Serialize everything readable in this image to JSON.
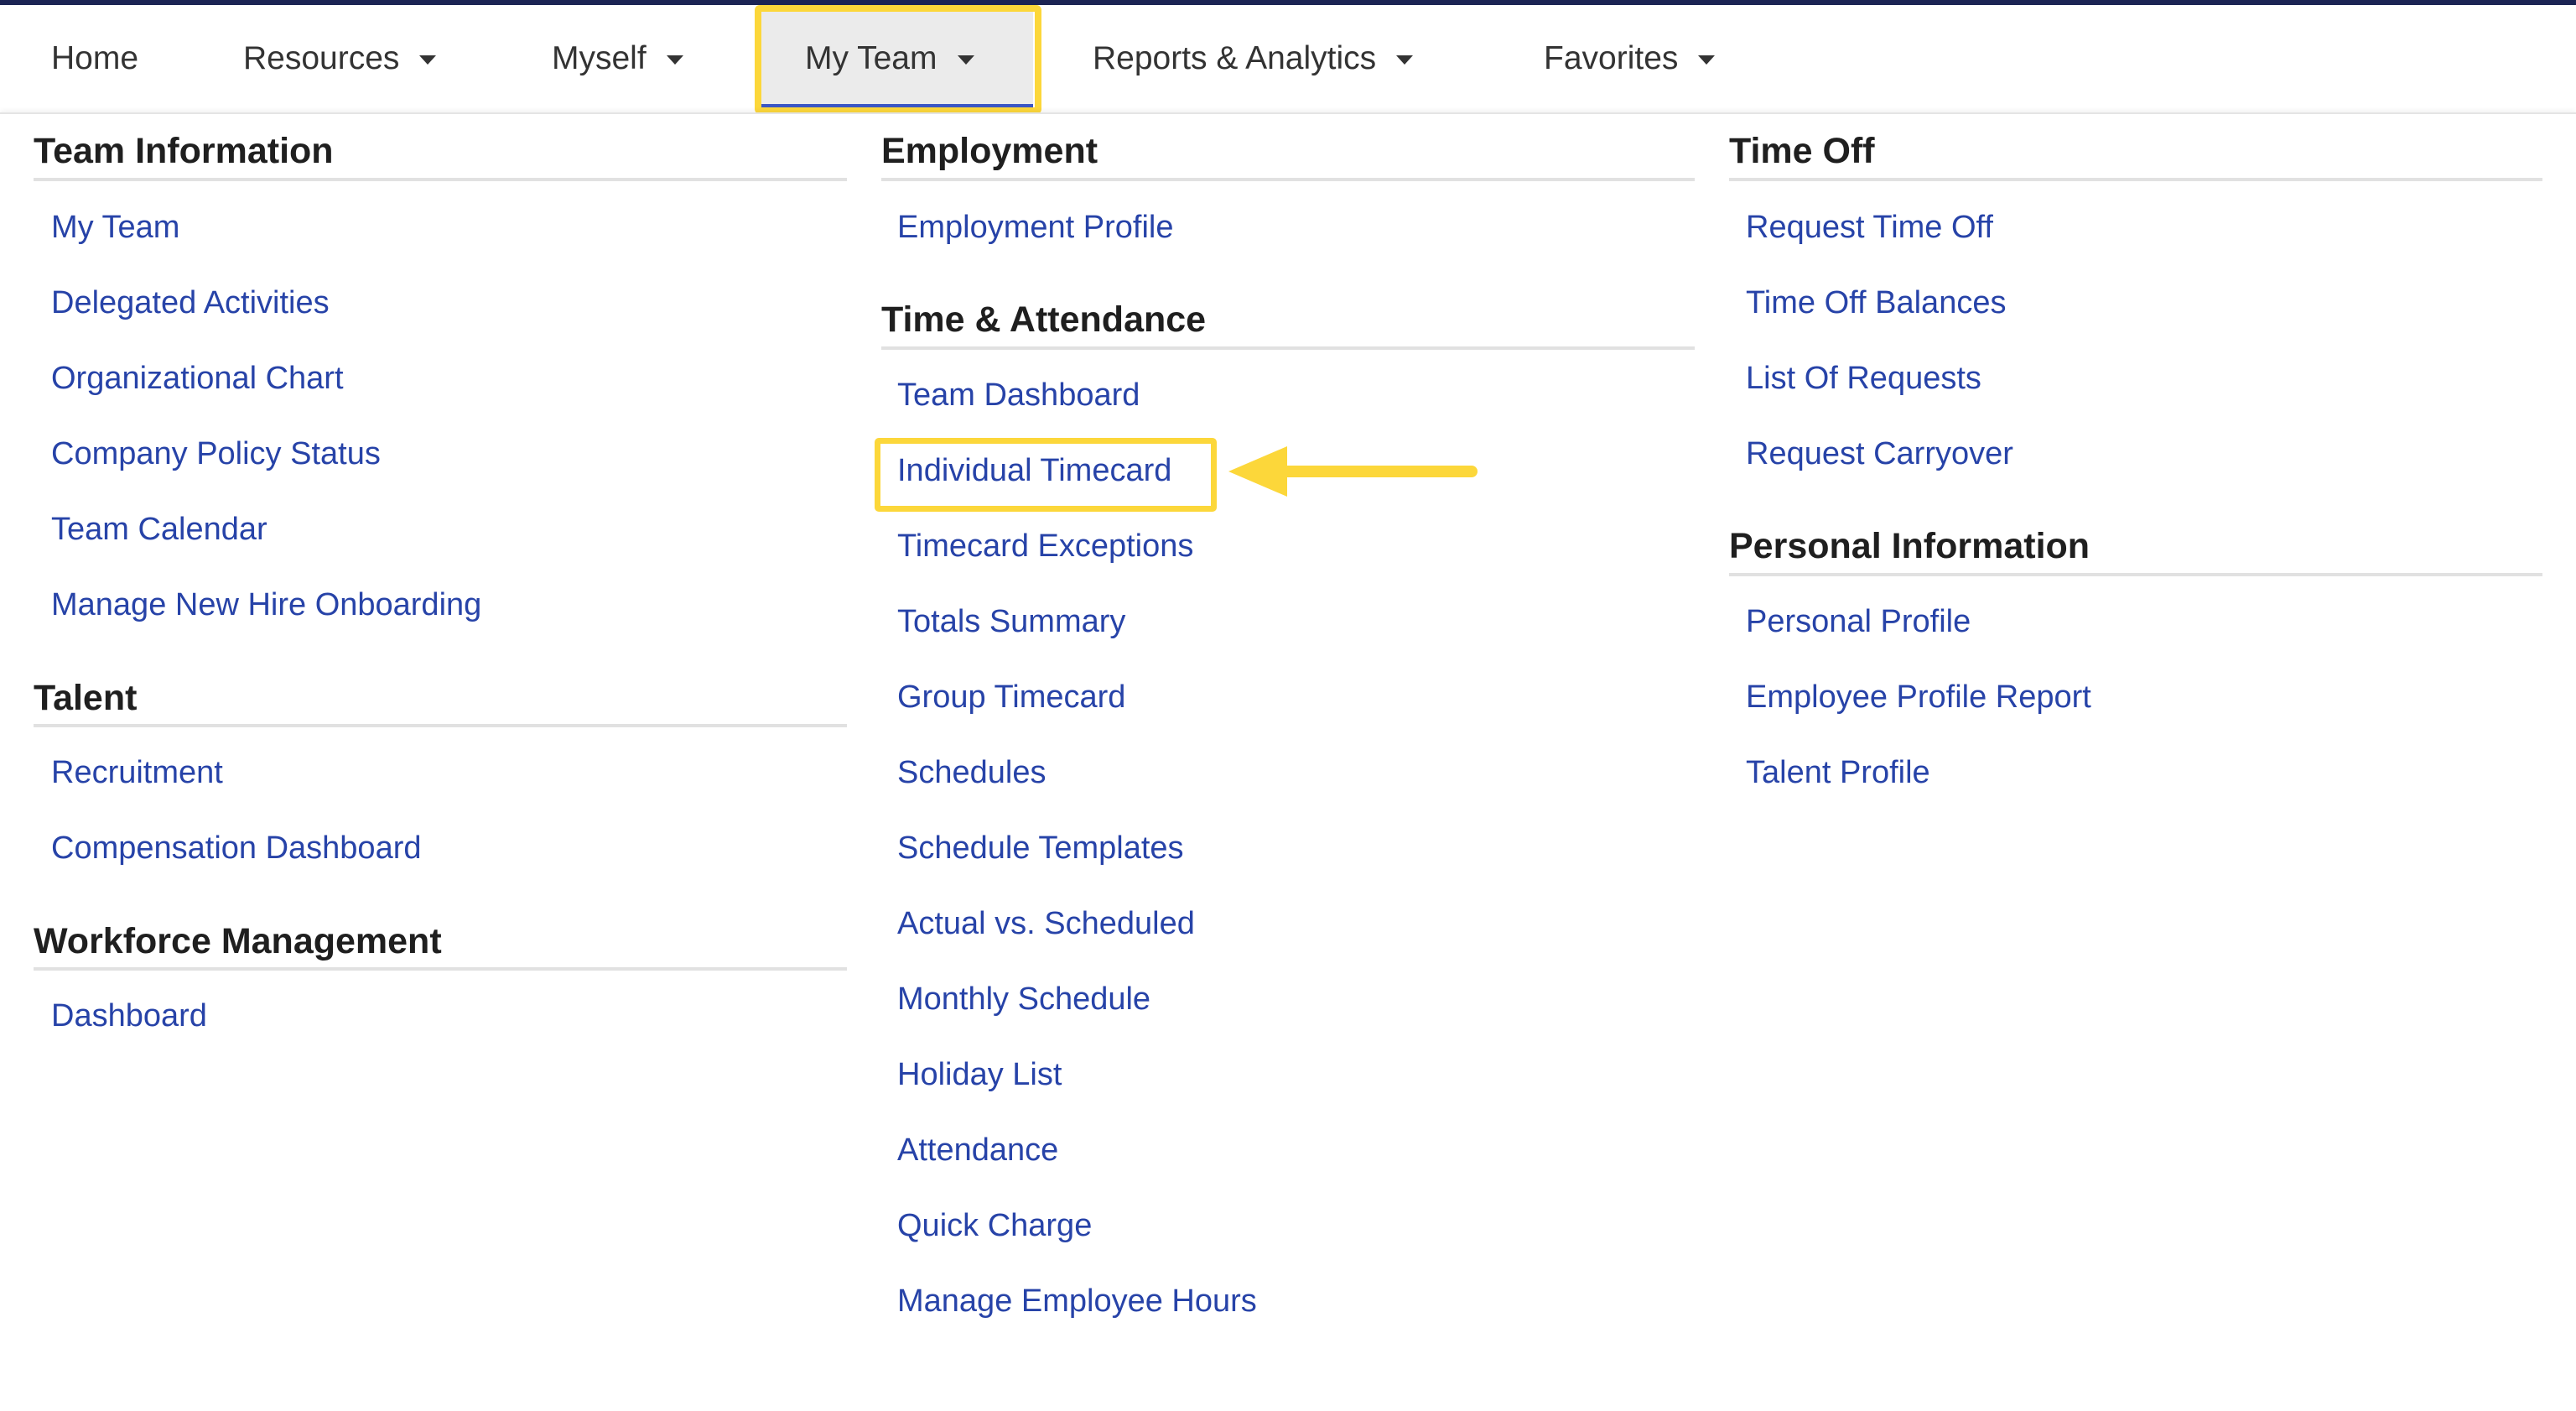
{
  "nav": {
    "items": [
      {
        "label": "Home"
      },
      {
        "label": "Resources"
      },
      {
        "label": "Myself"
      },
      {
        "label": "My Team"
      },
      {
        "label": "Reports & Analytics"
      },
      {
        "label": "Favorites"
      }
    ]
  },
  "colors": {
    "top_line": "#1c2454",
    "link": "#2743a8",
    "highlight": "#fcd73a",
    "tab_underline": "#3a56c4"
  },
  "menu": {
    "team_information": {
      "title": "Team Information",
      "links": [
        "My Team",
        "Delegated Activities",
        "Organizational Chart",
        "Company Policy Status",
        "Team Calendar",
        "Manage New Hire Onboarding"
      ]
    },
    "talent": {
      "title": "Talent",
      "links": [
        "Recruitment",
        "Compensation Dashboard"
      ]
    },
    "workforce_management": {
      "title": "Workforce Management",
      "links": [
        "Dashboard"
      ]
    },
    "employment": {
      "title": "Employment",
      "links": [
        "Employment Profile"
      ]
    },
    "time_attendance": {
      "title": "Time & Attendance",
      "links": [
        "Team Dashboard",
        "Individual Timecard",
        "Timecard Exceptions",
        "Totals Summary",
        "Group Timecard",
        "Schedules",
        "Schedule Templates",
        "Actual vs. Scheduled",
        "Monthly Schedule",
        "Holiday List",
        "Attendance",
        "Quick Charge",
        "Manage Employee Hours"
      ]
    },
    "time_off": {
      "title": "Time Off",
      "links": [
        "Request Time Off",
        "Time Off Balances",
        "List Of Requests",
        "Request Carryover"
      ]
    },
    "personal_information": {
      "title": "Personal Information",
      "links": [
        "Personal Profile",
        "Employee Profile Report",
        "Talent Profile"
      ]
    }
  }
}
